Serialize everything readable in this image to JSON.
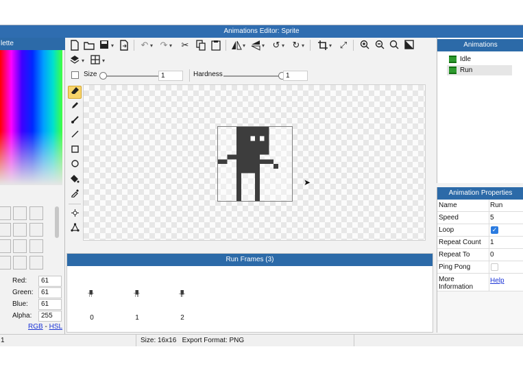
{
  "window": {
    "title": "Animations Editor: Sprite"
  },
  "palette": {
    "title": "lette",
    "channels": [
      {
        "label": "Red:",
        "value": "61"
      },
      {
        "label": "Green:",
        "value": "61"
      },
      {
        "label": "Blue:",
        "value": "61"
      },
      {
        "label": "Alpha:",
        "value": "255"
      }
    ],
    "link_rgb": "RGB",
    "link_sep": "-",
    "link_hsl": "HSL"
  },
  "toolbar": {
    "icons": [
      "new-file-icon",
      "open-folder-icon",
      "save-icon",
      "export-icon",
      "undo-icon",
      "redo-icon",
      "cut-icon",
      "copy-icon",
      "paste-icon",
      "flip-horizontal-icon",
      "flip-vertical-icon",
      "rotate-left-icon",
      "rotate-right-icon",
      "crop-icon",
      "resize-icon",
      "zoom-in-icon",
      "zoom-out-icon",
      "zoom-fit-icon",
      "contrast-icon",
      "layers-icon",
      "grid-icon"
    ]
  },
  "options": {
    "size_label": "Size",
    "size_value": "1",
    "hardness_label": "Hardness",
    "hardness_value": "1",
    "size_slider_level": 0.0,
    "hardness_slider_level": 1.0
  },
  "tools": [
    "eraser-icon",
    "pencil-icon",
    "brush-icon",
    "line-icon",
    "rectangle-icon",
    "ellipse-icon",
    "fill-icon",
    "eyedropper-icon",
    "select-point-icon",
    "transform-icon"
  ],
  "active_tool": "eraser-icon",
  "frames": {
    "title": "Run Frames (3)",
    "numbers": [
      "0",
      "1",
      "2"
    ]
  },
  "animations": {
    "title": "Animations",
    "items": [
      {
        "label": "Idle"
      },
      {
        "label": "Run"
      }
    ],
    "selected": "Run"
  },
  "properties": {
    "title": "Animation Properties",
    "rows": [
      {
        "name": "Name",
        "value": "Run"
      },
      {
        "name": "Speed",
        "value": "5"
      },
      {
        "name": "Loop",
        "value": "",
        "checked": true
      },
      {
        "name": "Repeat Count",
        "value": "1"
      },
      {
        "name": "Repeat To",
        "value": "0"
      },
      {
        "name": "Ping Pong",
        "value": "",
        "checked": false
      },
      {
        "name": "More Information",
        "value": "Help"
      }
    ]
  },
  "status": {
    "left": "1",
    "size": "Size: 16x16",
    "export": "Export Format: PNG"
  },
  "colors": {
    "accent": "#2c6aa8",
    "title_bar": "#2f6db0",
    "sprite": "#3d3d3d",
    "tool_active": "#f7d46a",
    "link": "#1a33d6"
  }
}
